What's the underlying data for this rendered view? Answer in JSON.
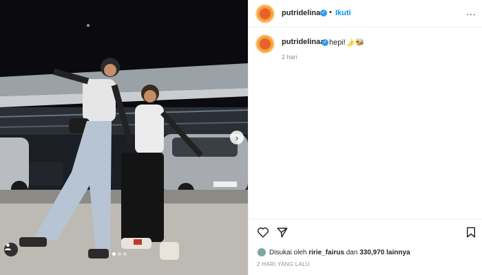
{
  "post": {
    "username": "putridelinaa",
    "verified": true,
    "follow_label": "Ikuti",
    "separator": "•",
    "more_label": "...",
    "caption": "hepi!🌛🐝",
    "caption_time": "2 hari",
    "likes": {
      "prefix": "Disukai oleh",
      "liker": "ririe_fairus",
      "middle": "dan",
      "count": "330,970",
      "suffix": "lainnya"
    },
    "posted_ago": "2 HARI YANG LALU"
  },
  "carousel": {
    "total": 3,
    "active_index": 0,
    "next_glyph": "›"
  },
  "icons": {
    "like": "heart-icon",
    "share": "send-icon",
    "save": "bookmark-icon",
    "tag": "user-tag-icon"
  },
  "colors": {
    "link": "#0095f6",
    "verified": "#3897f0",
    "muted": "#8e8e8e",
    "text": "#262626"
  }
}
